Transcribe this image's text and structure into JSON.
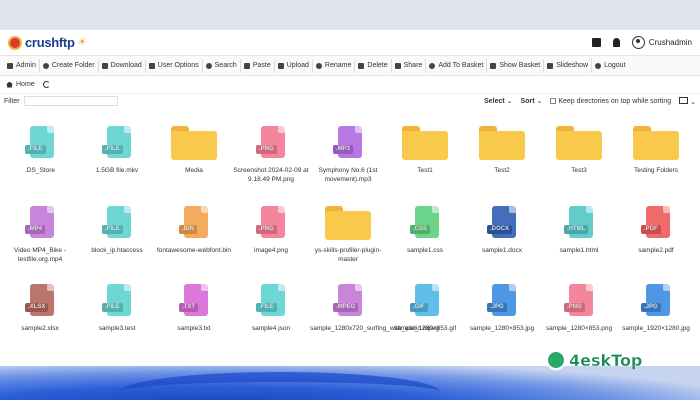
{
  "app": {
    "brand": "crushftp",
    "username": "Crushadmin"
  },
  "toolbar": [
    {
      "label": "Admin",
      "icon": "user-icon"
    },
    {
      "label": "Create Folder",
      "icon": "folder-plus-icon"
    },
    {
      "label": "Download",
      "icon": "download-icon"
    },
    {
      "label": "User Options",
      "icon": "gear-icon"
    },
    {
      "label": "Search",
      "icon": "search-icon"
    },
    {
      "label": "Paste",
      "icon": "paste-icon"
    },
    {
      "label": "Upload",
      "icon": "upload-icon"
    },
    {
      "label": "Rename",
      "icon": "rename-icon"
    },
    {
      "label": "Delete",
      "icon": "trash-icon"
    },
    {
      "label": "Share",
      "icon": "share-icon"
    },
    {
      "label": "Add To Basket",
      "icon": "add-basket-icon"
    },
    {
      "label": "Show Basket",
      "icon": "basket-icon"
    },
    {
      "label": "Slideshow",
      "icon": "image-icon"
    },
    {
      "label": "Logout",
      "icon": "lock-icon"
    }
  ],
  "breadcrumb": {
    "home": "Home"
  },
  "filter": {
    "label": "Filter",
    "value": "",
    "select": "Select",
    "sort": "Sort",
    "keep_dirs": "Keep directories on top while sorting"
  },
  "files": [
    {
      "name": ".DS_Store",
      "type": "file",
      "tag": ".FILE",
      "color": "#5ed3d0"
    },
    {
      "name": "1.5GB file.mkv",
      "type": "file",
      "tag": ".FILE",
      "color": "#5ed3d0"
    },
    {
      "name": "Media",
      "type": "folder"
    },
    {
      "name": "Screenshot 2024-02-09 at 9.18.49 PM.png",
      "type": "file",
      "tag": ".PNG",
      "color": "#f27a92"
    },
    {
      "name": "Symphony No.6 (1st movement).mp3",
      "type": "file",
      "tag": ".MP3",
      "color": "#b06ae0"
    },
    {
      "name": "Test1",
      "type": "folder"
    },
    {
      "name": "Test2",
      "type": "folder"
    },
    {
      "name": "Test3",
      "type": "folder"
    },
    {
      "name": "Testing Folders",
      "type": "folder"
    },
    {
      "name": "Video MP4_Bike - testfile.org.mp4",
      "type": "file",
      "tag": ".MP4",
      "color": "#c27ad6"
    },
    {
      "name": "block_ip.htaccess",
      "type": "file",
      "tag": ".FILE",
      "color": "#5ed3d0"
    },
    {
      "name": "fontawesome-webfont.bin",
      "type": "file",
      "tag": ".BIN",
      "color": "#f3a24c"
    },
    {
      "name": "image4.png",
      "type": "file",
      "tag": ".PNG",
      "color": "#f27a92"
    },
    {
      "name": "ys-skills-profiler-plugin-master",
      "type": "folder"
    },
    {
      "name": "sample1.css",
      "type": "file",
      "tag": ".CSS",
      "color": "#5ccf7e"
    },
    {
      "name": "sample1.docx",
      "type": "file",
      "tag": ".DOCX",
      "color": "#2f5fb3"
    },
    {
      "name": "sample1.html",
      "type": "file",
      "tag": ".HTML",
      "color": "#52c7c7"
    },
    {
      "name": "sample2.pdf",
      "type": "file",
      "tag": ".PDF",
      "color": "#ef5a5a"
    },
    {
      "name": "sample2.xlsx",
      "type": "file",
      "tag": ".XLSX",
      "color": "#b5655f"
    },
    {
      "name": "sample3.test",
      "type": "file",
      "tag": ".FILE",
      "color": "#5ed3d0"
    },
    {
      "name": "sample3.txt",
      "type": "file",
      "tag": ".TXT",
      "color": "#d86ad6"
    },
    {
      "name": "sample4.json",
      "type": "file",
      "tag": ".FILE",
      "color": "#5ed3d0"
    },
    {
      "name": "sample_1280x720_surfing_with_audio.mpeg",
      "type": "file",
      "tag": ".MPEG",
      "color": "#c27ad6"
    },
    {
      "name": "sample_1280×853.gif",
      "type": "file",
      "tag": ".GIF",
      "color": "#4fb8e6"
    },
    {
      "name": "sample_1280×853.jpg",
      "type": "file",
      "tag": ".JPG",
      "color": "#3d8be0"
    },
    {
      "name": "sample_1280×853.png",
      "type": "file",
      "tag": ".PNG",
      "color": "#f27a92"
    },
    {
      "name": "sample_1920×1280.jpg",
      "type": "file",
      "tag": ".JPG",
      "color": "#3d8be0"
    }
  ],
  "watermark": {
    "text": "4eskTop"
  }
}
